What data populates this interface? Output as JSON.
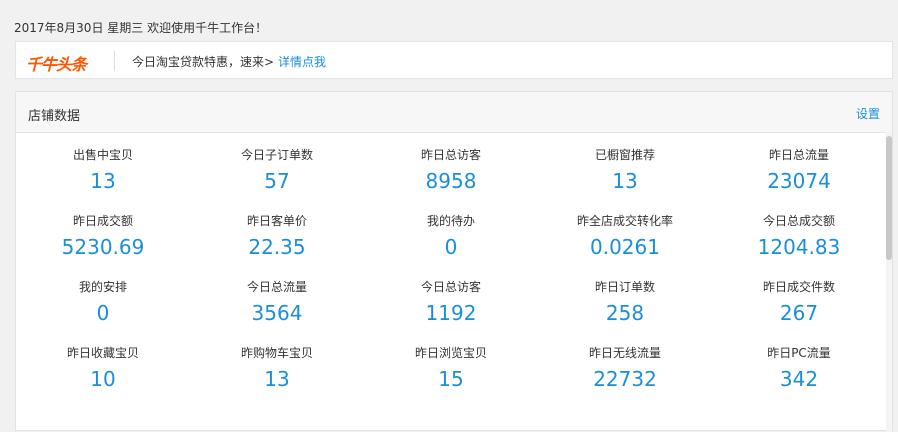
{
  "welcome": "2017年8月30日 星期三 欢迎使用千牛工作台！",
  "headline": {
    "logo": "千牛头条",
    "text": "今日淘宝贷款特惠，速来>",
    "link": "详情点我"
  },
  "panel": {
    "title": "店铺数据",
    "action": "设置"
  },
  "stats": [
    {
      "label": "出售中宝贝",
      "value": "13"
    },
    {
      "label": "今日子订单数",
      "value": "57"
    },
    {
      "label": "昨日总访客",
      "value": "8958"
    },
    {
      "label": "已橱窗推荐",
      "value": "13"
    },
    {
      "label": "昨日总流量",
      "value": "23074"
    },
    {
      "label": "昨日成交额",
      "value": "5230.69"
    },
    {
      "label": "昨日客单价",
      "value": "22.35"
    },
    {
      "label": "我的待办",
      "value": "0"
    },
    {
      "label": "昨全店成交转化率",
      "value": "0.0261"
    },
    {
      "label": "今日总成交额",
      "value": "1204.83"
    },
    {
      "label": "我的安排",
      "value": "0"
    },
    {
      "label": "今日总流量",
      "value": "3564"
    },
    {
      "label": "今日总访客",
      "value": "1192"
    },
    {
      "label": "昨日订单数",
      "value": "258"
    },
    {
      "label": "昨日成交件数",
      "value": "267"
    },
    {
      "label": "昨日收藏宝贝",
      "value": "10"
    },
    {
      "label": "昨购物车宝贝",
      "value": "13"
    },
    {
      "label": "昨日浏览宝贝",
      "value": "15"
    },
    {
      "label": "昨日无线流量",
      "value": "22732"
    },
    {
      "label": "昨日PC流量",
      "value": "342"
    }
  ]
}
